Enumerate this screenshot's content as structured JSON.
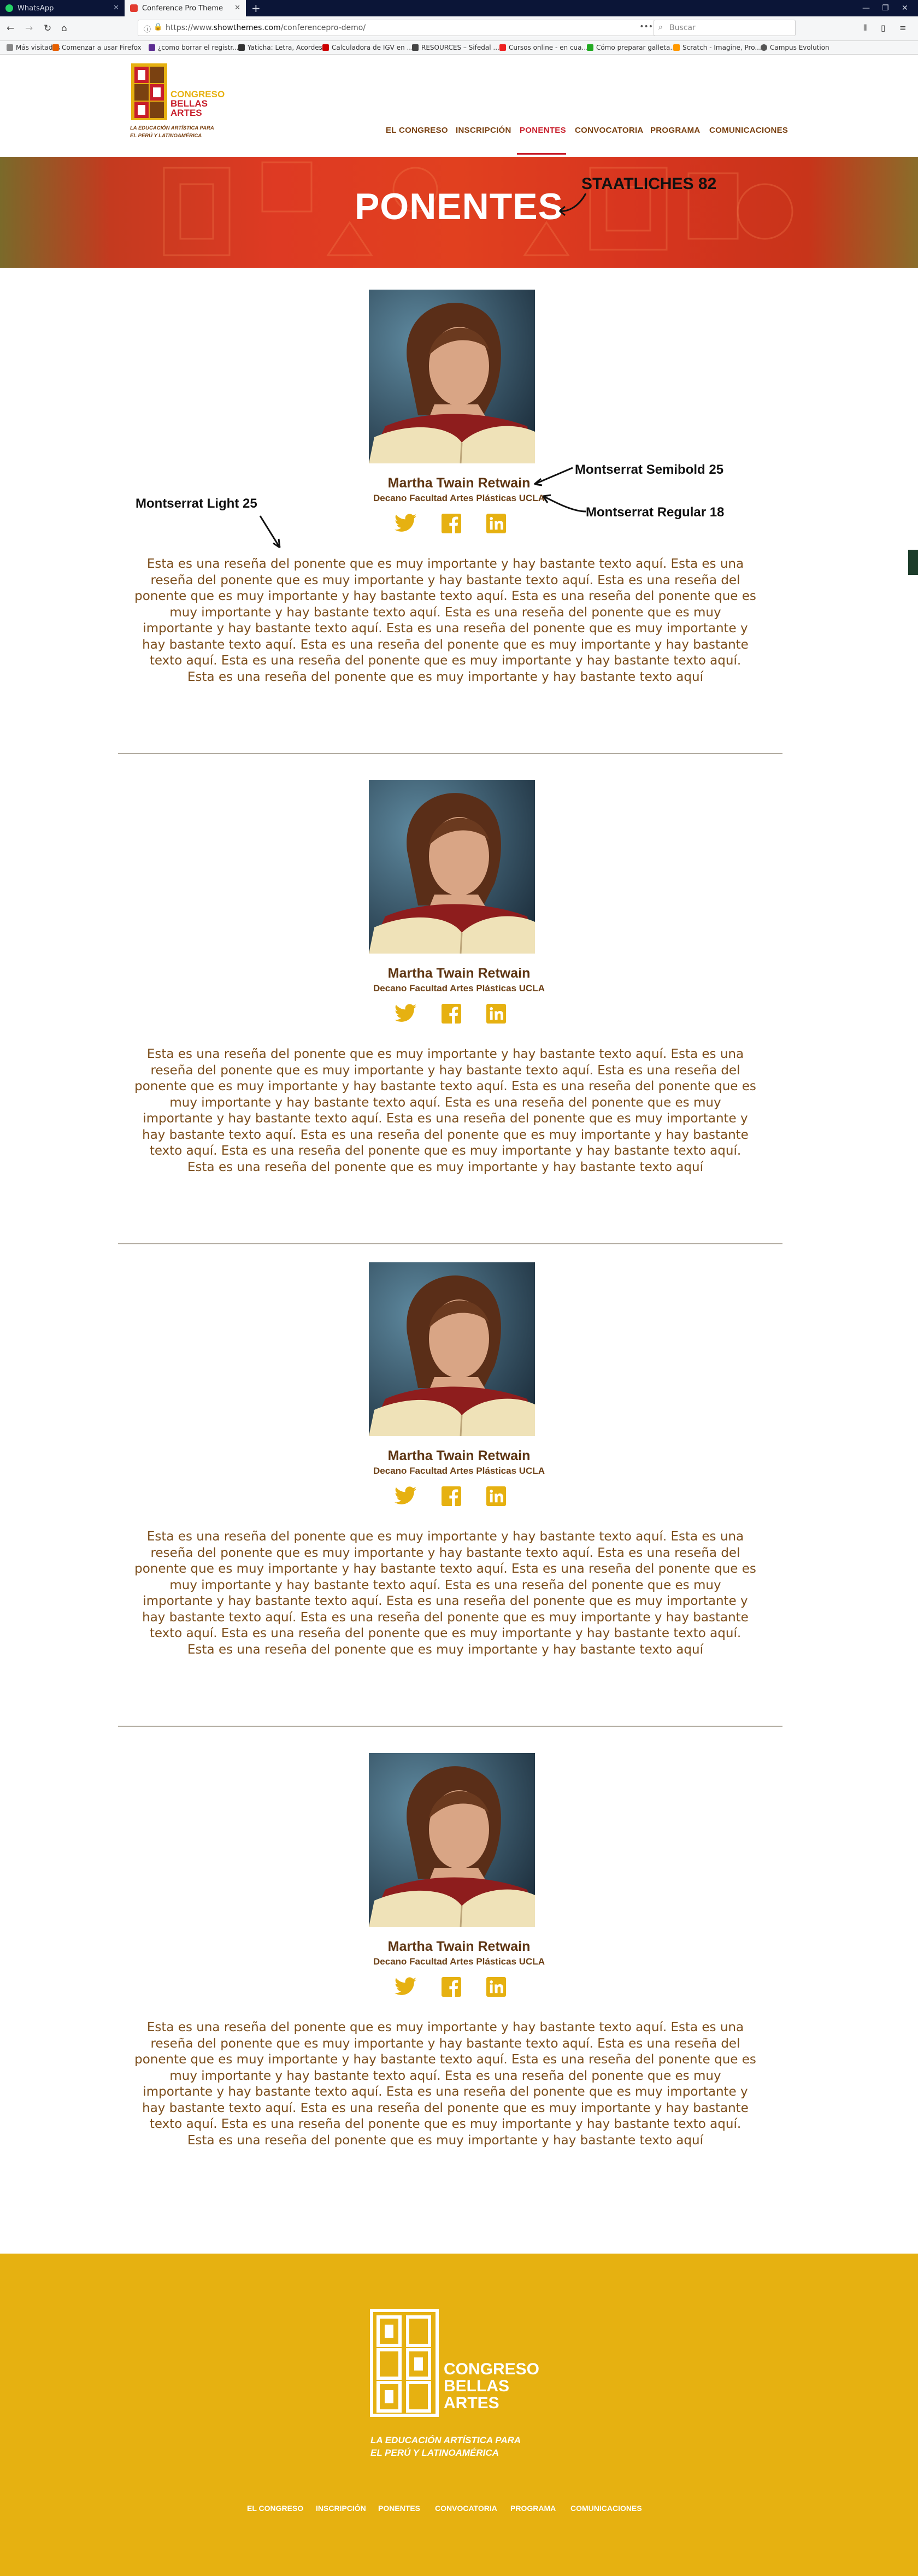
{
  "browser": {
    "tabs": [
      {
        "label": "WhatsApp",
        "icon": "whatsapp-icon",
        "color": "#25d366"
      },
      {
        "label": "Conference Pro Theme",
        "icon": "page-favicon-icon",
        "color": "#e23c30"
      }
    ],
    "url_prefix": "https://www.",
    "url_domain": "showthemes.com",
    "url_path": "/conferencepro-demo/",
    "search_placeholder": "Buscar",
    "bookmarks": [
      "Más visitados",
      "Comenzar a usar Firefox",
      "¿como borrar el registr...",
      "Yaticha: Letra, Acordes...",
      "Calculadora de IGV en ...",
      "RESOURCES – Sifedal ...",
      "Cursos online - en cua...",
      "Cómo preparar galleta...",
      "Scratch - Imagine, Pro...",
      "Campus Evolution"
    ]
  },
  "site": {
    "logo": {
      "line1": "CONGRESO",
      "line2": "BELLAS",
      "line3": "ARTES",
      "tagline1": "LA EDUCACIÓN ARTÍSTICA PARA",
      "tagline2": "EL PERÚ Y LATINOAMÉRICA"
    },
    "nav": [
      "EL CONGRESO",
      "INSCRIPCIÓN",
      "PONENTES",
      "CONVOCATORIA",
      "PROGRAMA",
      "COMUNICACIONES"
    ],
    "active_nav": "PONENTES",
    "colors": {
      "brand_red": "#c81e2b",
      "brand_yellow": "#e6b111",
      "text_brown": "#7c4e1c",
      "name_brown": "#5e3512"
    }
  },
  "hero": {
    "title": "PONENTES"
  },
  "annotations": {
    "hero_font": "STAATLICHES 82",
    "name_font": "Montserrat Semibold 25",
    "role_font": "Montserrat Regular 18",
    "bio_font": "Montserrat Light 25"
  },
  "speakers": [
    {
      "name": "Martha Twain Retwain",
      "role": "Decano Facultad Artes Plásticas UCLA",
      "social": [
        "twitter-icon",
        "facebook-icon",
        "linkedin-icon"
      ],
      "bio": "Esta es una reseña del ponente que es muy importante y hay bastante texto aquí. Esta es una reseña del ponente que es muy importante y hay bastante texto aquí. Esta es una reseña del ponente que es muy importante y hay bastante texto aquí. Esta es una reseña del ponente que es muy importante y hay bastante texto aquí. Esta es una reseña del ponente que es muy importante y hay bastante texto aquí. Esta es una reseña del ponente que es muy importante y hay bastante texto aquí. Esta es una reseña del ponente que es muy importante y hay bastante texto aquí. Esta es una reseña del ponente que es muy importante y hay bastante texto aquí. Esta es una reseña del ponente que es muy importante y hay bastante texto aquí"
    },
    {
      "name": "Martha Twain Retwain",
      "role": "Decano Facultad Artes Plásticas UCLA",
      "social": [
        "twitter-icon",
        "facebook-icon",
        "linkedin-icon"
      ],
      "bio": "Esta es una reseña del ponente que es muy importante y hay bastante texto aquí. Esta es una reseña del ponente que es muy importante y hay bastante texto aquí. Esta es una reseña del ponente que es muy importante y hay bastante texto aquí. Esta es una reseña del ponente que es muy importante y hay bastante texto aquí. Esta es una reseña del ponente que es muy importante y hay bastante texto aquí. Esta es una reseña del ponente que es muy importante y hay bastante texto aquí. Esta es una reseña del ponente que es muy importante y hay bastante texto aquí. Esta es una reseña del ponente que es muy importante y hay bastante texto aquí. Esta es una reseña del ponente que es muy importante y hay bastante texto aquí"
    },
    {
      "name": "Martha Twain Retwain",
      "role": "Decano Facultad Artes Plásticas UCLA",
      "social": [
        "twitter-icon",
        "facebook-icon",
        "linkedin-icon"
      ],
      "bio": "Esta es una reseña del ponente que es muy importante y hay bastante texto aquí. Esta es una reseña del ponente que es muy importante y hay bastante texto aquí. Esta es una reseña del ponente que es muy importante y hay bastante texto aquí. Esta es una reseña del ponente que es muy importante y hay bastante texto aquí. Esta es una reseña del ponente que es muy importante y hay bastante texto aquí. Esta es una reseña del ponente que es muy importante y hay bastante texto aquí. Esta es una reseña del ponente que es muy importante y hay bastante texto aquí. Esta es una reseña del ponente que es muy importante y hay bastante texto aquí. Esta es una reseña del ponente que es muy importante y hay bastante texto aquí"
    },
    {
      "name": "Martha Twain Retwain",
      "role": "Decano Facultad Artes Plásticas UCLA",
      "social": [
        "twitter-icon",
        "facebook-icon",
        "linkedin-icon"
      ],
      "bio": "Esta es una reseña del ponente que es muy importante y hay bastante texto aquí. Esta es una reseña del ponente que es muy importante y hay bastante texto aquí. Esta es una reseña del ponente que es muy importante y hay bastante texto aquí. Esta es una reseña del ponente que es muy importante y hay bastante texto aquí. Esta es una reseña del ponente que es muy importante y hay bastante texto aquí. Esta es una reseña del ponente que es muy importante y hay bastante texto aquí. Esta es una reseña del ponente que es muy importante y hay bastante texto aquí. Esta es una reseña del ponente que es muy importante y hay bastante texto aquí. Esta es una reseña del ponente que es muy importante y hay bastante texto aquí"
    }
  ],
  "footer": {
    "logo": {
      "line1": "CONGRESO",
      "line2": "BELLAS",
      "line3": "ARTES",
      "tagline1": "LA EDUCACIÓN ARTÍSTICA PARA",
      "tagline2": "EL PERÚ Y LATINOAMÉRICA"
    },
    "nav": [
      "EL CONGRESO",
      "INSCRIPCIÓN",
      "PONENTES",
      "CONVOCATORIA",
      "PROGRAMA",
      "COMUNICACIONES"
    ]
  }
}
